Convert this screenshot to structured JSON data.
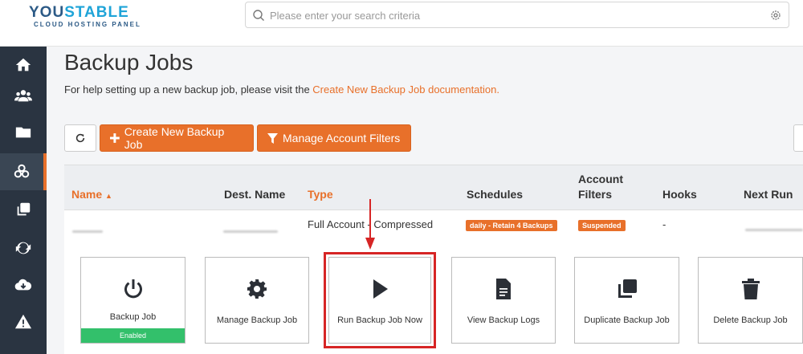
{
  "brand": {
    "name_part1": "YOU",
    "name_part2": "STABLE",
    "subtitle": "CLOUD HOSTING PANEL"
  },
  "search": {
    "placeholder": "Please enter your search criteria",
    "value": ""
  },
  "sidebar": {
    "items": [
      {
        "icon": "home-icon"
      },
      {
        "icon": "users-icon"
      },
      {
        "icon": "folder-icon"
      },
      {
        "icon": "backup-icon",
        "active": true
      },
      {
        "icon": "copy-icon"
      },
      {
        "icon": "sync-icon"
      },
      {
        "icon": "cloud-download-icon"
      },
      {
        "icon": "warning-icon"
      }
    ]
  },
  "page": {
    "title": "Backup Jobs",
    "help_text": "For help setting up a new backup job, please visit the ",
    "help_link": "Create New Backup Job documentation."
  },
  "toolbar": {
    "create_label": "Create New Backup Job",
    "filters_label": "Manage Account Filters"
  },
  "table": {
    "headers": {
      "name": "Name",
      "dest_name": "Dest. Name",
      "type": "Type",
      "schedules": "Schedules",
      "account_filters_1": "Account",
      "account_filters_2": "Filters",
      "hooks": "Hooks",
      "next_run": "Next Run"
    },
    "row": {
      "type": "Full Account - Compressed",
      "schedule_badge": "daily - Retain 4 Backups",
      "filter_badge": "Suspended",
      "hooks": "-"
    }
  },
  "actions": {
    "backup_job": "Backup Job",
    "backup_job_status": "Enabled",
    "manage": "Manage Backup Job",
    "run_now": "Run Backup Job Now",
    "logs": "View Backup Logs",
    "duplicate": "Duplicate Backup Job",
    "delete": "Delete Backup Job"
  },
  "colors": {
    "accent": "#e8702a",
    "sidebar": "#2a3441",
    "enabled": "#33c06b",
    "highlight": "#d62525"
  }
}
